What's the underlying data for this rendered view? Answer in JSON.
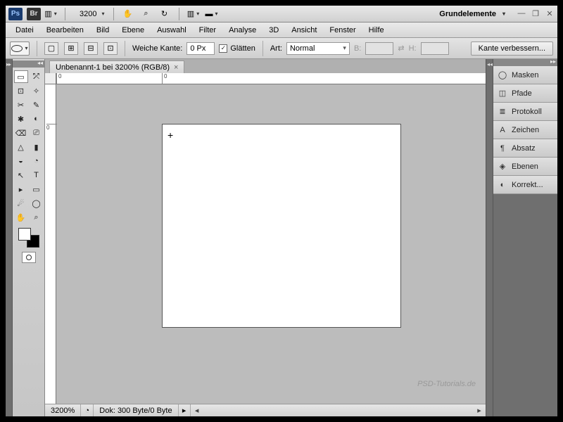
{
  "appbar": {
    "zoom": "3200",
    "workspace": "Grundelemente"
  },
  "menu": {
    "items": [
      "Datei",
      "Bearbeiten",
      "Bild",
      "Ebene",
      "Auswahl",
      "Filter",
      "Analyse",
      "3D",
      "Ansicht",
      "Fenster",
      "Hilfe"
    ]
  },
  "options": {
    "feather_label": "Weiche Kante:",
    "feather_value": "0 Px",
    "antialias_label": "Glätten",
    "antialias_checked": "✓",
    "style_label": "Art:",
    "style_value": "Normal",
    "width_label": "B:",
    "height_label": "H:",
    "refine_edge": "Kante verbessern..."
  },
  "document": {
    "tab_title": "Unbenannt-1 bei 3200% (RGB/8)",
    "ruler_origin": "0",
    "ruler_origin2": "0"
  },
  "status": {
    "zoom": "3200%",
    "doc_info": "Dok: 300 Byte/0 Byte"
  },
  "watermark": "PSD-Tutorials.de",
  "panels": {
    "items": [
      {
        "icon": "◯",
        "label": "Masken"
      },
      {
        "icon": "◫",
        "label": "Pfade"
      },
      {
        "icon": "≣",
        "label": "Protokoll"
      },
      {
        "icon": "A",
        "label": "Zeichen"
      },
      {
        "icon": "¶",
        "label": "Absatz"
      },
      {
        "icon": "◈",
        "label": "Ebenen"
      },
      {
        "icon": "◐",
        "label": "Korrekt..."
      }
    ]
  },
  "tools": {
    "rows": [
      [
        "▭",
        "⤱"
      ],
      [
        "⊡",
        "✧"
      ],
      [
        "✂",
        "✎"
      ],
      [
        "✱",
        "◐"
      ],
      [
        "⌫",
        "⎚"
      ],
      [
        "△",
        "▮"
      ],
      [
        "◒",
        "◔"
      ],
      [
        "↖",
        "T"
      ],
      [
        "▸",
        "▭"
      ],
      [
        "☄",
        "◯"
      ],
      [
        "✋",
        "⌕"
      ]
    ]
  }
}
